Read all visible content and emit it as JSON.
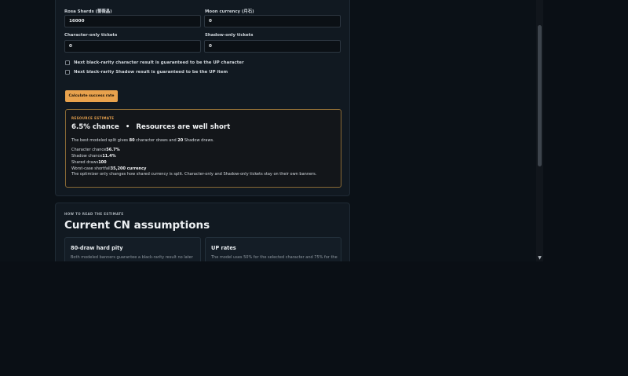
{
  "form": {
    "rosa_label": "Rosa Shards (蔷薇晶)",
    "rosa_value": "16000",
    "moon_label": "Moon currency (月石)",
    "moon_value": "0",
    "char_tickets_label": "Character-only tickets",
    "char_tickets_value": "0",
    "shadow_tickets_label": "Shadow-only tickets",
    "shadow_tickets_value": "0",
    "check_character": "Next black-rarity character result is guaranteed to be the UP character",
    "check_shadow": "Next black-rarity Shadow result is guaranteed to be the UP item",
    "calculate_button": "Calculate success rate"
  },
  "estimate": {
    "eyebrow": "RESOURCE ESTIMATE",
    "chance": "6.5% chance",
    "separator": "•",
    "verdict": "Resources are well short",
    "split_prefix": "The best modeled split gives ",
    "char_draws": "80",
    "split_mid": " character draws and ",
    "shadow_draws": "20",
    "split_suffix": " Shadow draws.",
    "character_chance_label": "Character chance",
    "character_chance_value": "56.7%",
    "shadow_chance_label": "Shadow chance",
    "shadow_chance_value": "11.4%",
    "shared_draws_label": "Shared draws",
    "shared_draws_value": "100",
    "shortfall_label": "Worst-case shortfall",
    "shortfall_value": "35,200 currency",
    "note": "The optimizer only changes how shared currency is split. Character-only and Shadow-only tickets stay on their own banners."
  },
  "guide": {
    "eyebrow": "HOW TO READ THE ESTIMATE",
    "heading": "Current CN assumptions",
    "card1_title": "80-draw hard pity",
    "card1_body": "Both modeled banners guarantee a black-rarity result no later",
    "card2_title": "UP rates",
    "card2_body": "The model uses 50% for the selected character and 75% for the"
  },
  "colors": {
    "accent": "#e8a24d",
    "eyebrow_estimate": "#e8a24d",
    "eyebrow_guide": "#aeb6bd",
    "panel": "#111921",
    "page": "#0a0f15"
  }
}
